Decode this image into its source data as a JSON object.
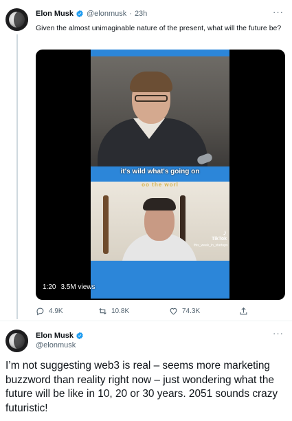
{
  "tweet1": {
    "author_name": "Elon Musk",
    "author_handle": "@elonmusk",
    "separator": "·",
    "time": "23h",
    "text": "Given the almost unimaginable nature of the present, what will the future be?",
    "video": {
      "caption": "it's wild what's going on",
      "caption2": "oo the worl",
      "watermark": "TikTok",
      "watermark_handle": "this_week_in_startups",
      "duration": "1:20",
      "views": "3.5M views"
    },
    "actions": {
      "replies": "4.9K",
      "retweets": "10.8K",
      "likes": "74.3K"
    }
  },
  "tweet2": {
    "author_name": "Elon Musk",
    "author_handle": "@elonmusk",
    "text": "I’m not suggesting web3 is real – seems more marketing buzzword than reality right now – just wondering what the future will be like in 10, 20 or 30 years. 2051 sounds crazy futuristic!"
  },
  "more_glyph": "···",
  "colors": {
    "verified": "#1d9bf0",
    "secondary_text": "#536471",
    "video_frame": "#2c86d9"
  },
  "icons": [
    "verified-badge-icon",
    "more-icon",
    "reply-icon",
    "retweet-icon",
    "like-icon",
    "share-icon",
    "avatar"
  ]
}
